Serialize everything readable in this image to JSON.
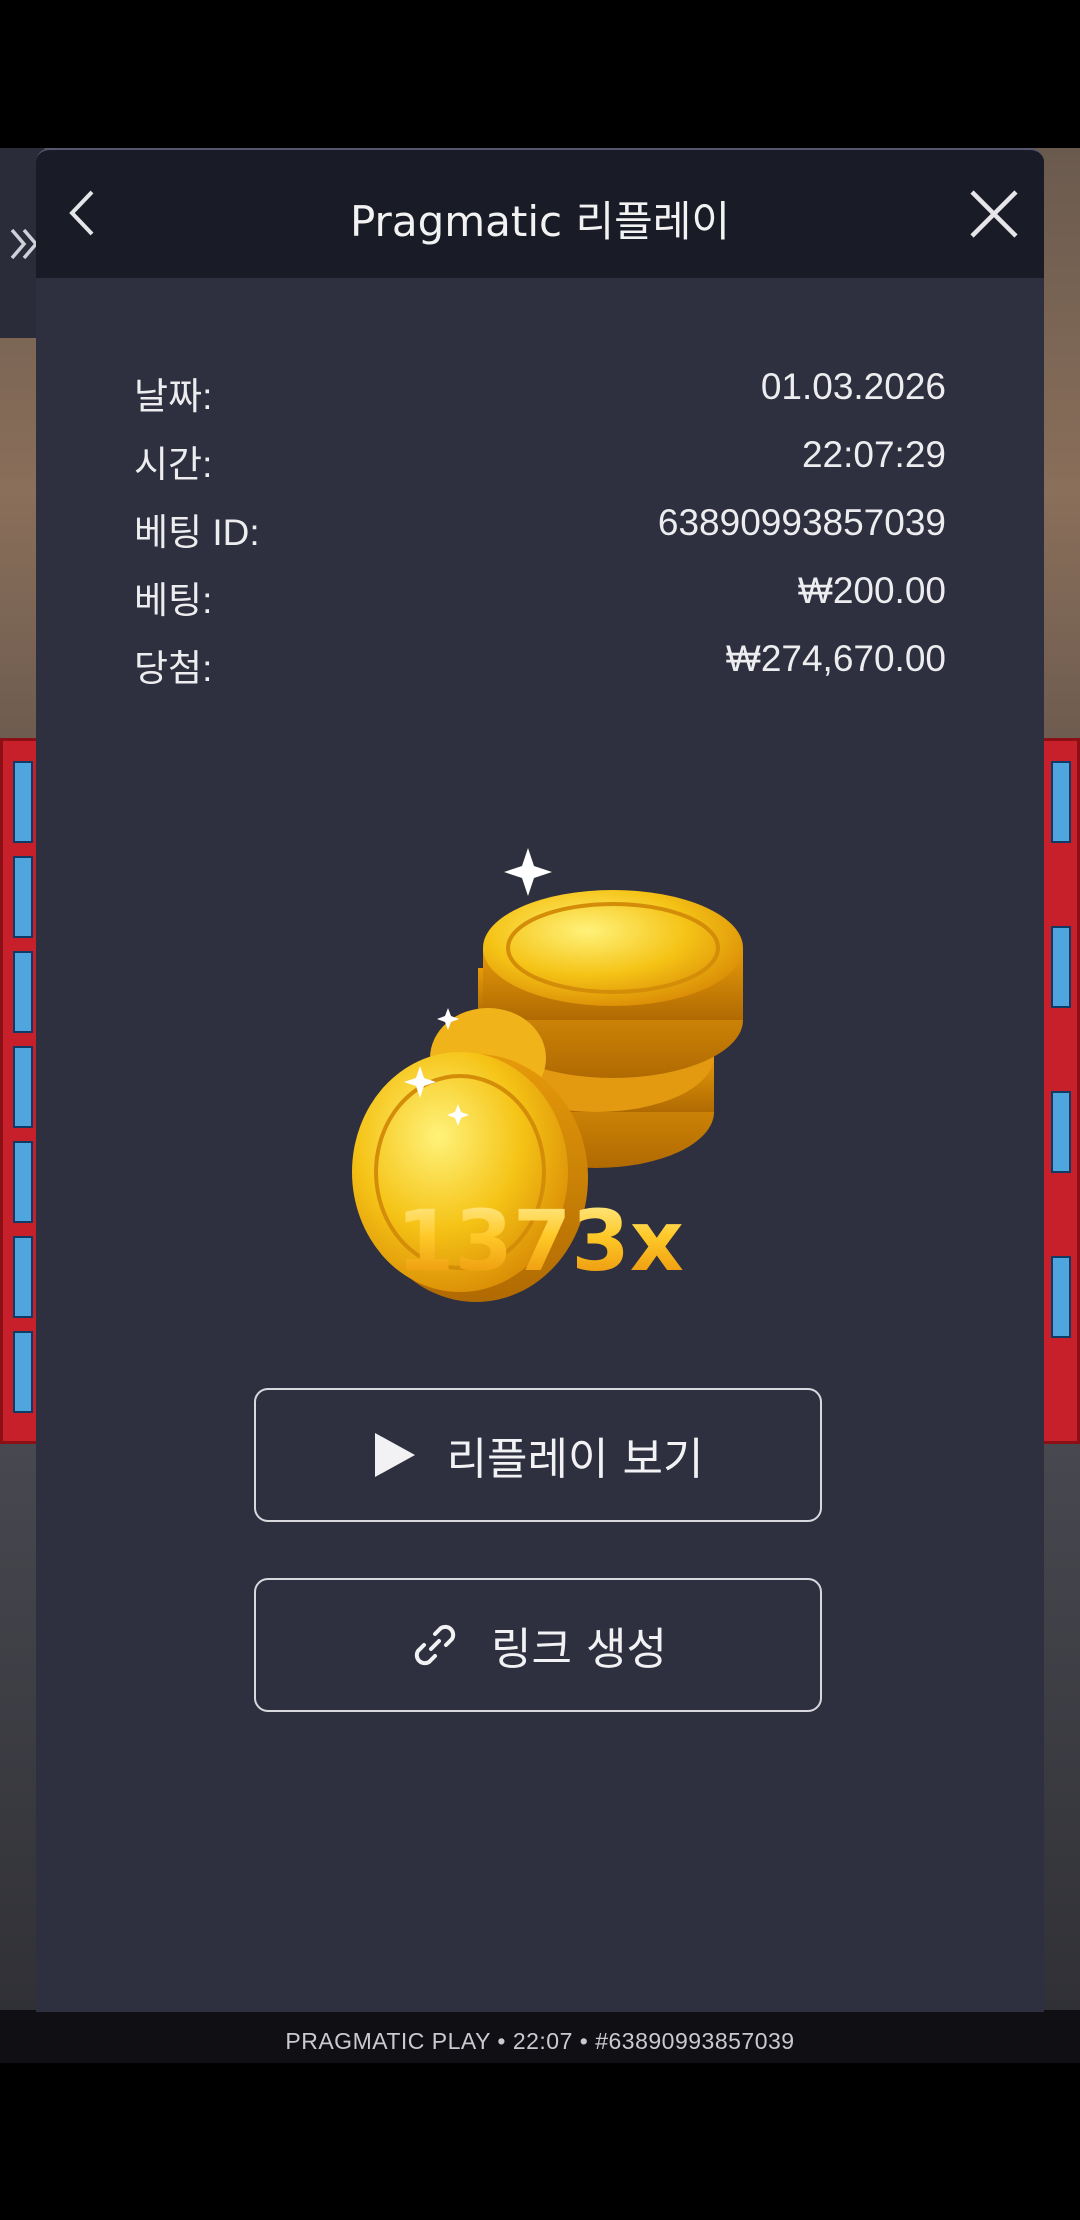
{
  "modal": {
    "title": "Pragmatic 리플레이"
  },
  "info": {
    "date_label": "날짜:",
    "date_value": "01.03.2026",
    "time_label": "시간:",
    "time_value": "22:07:29",
    "bet_id_label": "베팅 ID:",
    "bet_id_value": "63890993857039",
    "bet_label": "베팅:",
    "bet_value": "₩200.00",
    "win_label": "당첨:",
    "win_value": "₩274,670.00"
  },
  "result": {
    "multiplier": "1373x"
  },
  "buttons": {
    "replay_label": "리플레이 보기",
    "link_label": "링크 생성"
  },
  "footer": {
    "text": "PRAGMATIC PLAY • 22:07 • #63890993857039"
  },
  "icons": {
    "back": "chevron-left-icon",
    "close": "close-icon",
    "play": "play-icon",
    "link": "link-icon",
    "side": "double-chevron-right-icon"
  },
  "colors": {
    "modal_bg": "#2f303f",
    "header_bg": "#191b26",
    "multiplier_gold": "#f7b11c"
  }
}
